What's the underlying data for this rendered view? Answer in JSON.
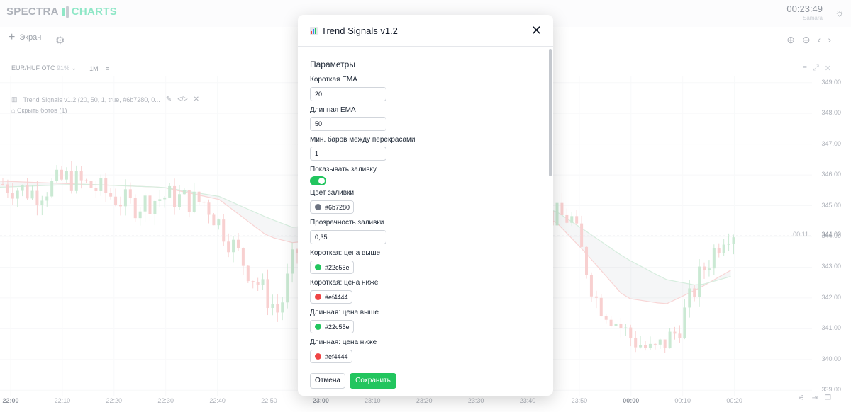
{
  "app": {
    "logo_left": "SPECTRA",
    "logo_right": "CHARTS",
    "clock": "00:23:49",
    "timezone": "Samara",
    "theme_icon": "sun-icon"
  },
  "toolbar": {
    "screen_label": "Экран",
    "add_icon": "plus-icon",
    "settings_icon": "gear-icon",
    "zoom_in_icon": "zoom-in-icon",
    "zoom_out_icon": "zoom-out-icon",
    "prev_icon": "chevron-left-icon",
    "next_icon": "chevron-right-icon"
  },
  "chart_header": {
    "symbol": "EUR/HUF OTC",
    "payout": "91%",
    "timeframe": "1M",
    "indicator": "Trend Signals v1.2 (20, 50, 1, true, #6b7280, 0...",
    "hide_bots": "Скрыть ботов (1)"
  },
  "chart_data": {
    "type": "candlestick",
    "y_ticks": [
      "349.00",
      "348.00",
      "347.00",
      "346.00",
      "345.00",
      "344.00",
      "343.00",
      "342.00",
      "341.00",
      "340.00",
      "339.00"
    ],
    "x_ticks": [
      "22:00",
      "22:10",
      "22:20",
      "22:30",
      "22:40",
      "22:50",
      "23:00",
      "23:10",
      "23:20",
      "23:30",
      "23:40",
      "23:50",
      "00:00",
      "00:10",
      "00:20"
    ],
    "x_ticks_bold": [
      "22:00",
      "23:00",
      "00:00"
    ],
    "current_price": "344.02",
    "current_timer": "00:11",
    "ylim": [
      338.8,
      349.2
    ],
    "up_color": "#22c55e",
    "down_color": "#ef4444",
    "ema_fill_color": "#6b7280",
    "close_path": [
      {
        "x": 0,
        "y": 345.7
      },
      {
        "x": 0.04,
        "y": 345.4
      },
      {
        "x": 0.08,
        "y": 345.9
      },
      {
        "x": 0.12,
        "y": 345.5
      },
      {
        "x": 0.16,
        "y": 345.0
      },
      {
        "x": 0.2,
        "y": 345.3
      },
      {
        "x": 0.25,
        "y": 345.1
      },
      {
        "x": 0.3,
        "y": 343.0
      },
      {
        "x": 0.34,
        "y": 341.5
      },
      {
        "x": 0.36,
        "y": 343.5
      },
      {
        "x": 0.66,
        "y": 344.7
      },
      {
        "x": 0.7,
        "y": 344.6
      },
      {
        "x": 0.73,
        "y": 342.0
      },
      {
        "x": 0.77,
        "y": 340.8
      },
      {
        "x": 0.8,
        "y": 340.2
      },
      {
        "x": 0.83,
        "y": 340.9
      },
      {
        "x": 0.86,
        "y": 342.8
      },
      {
        "x": 0.89,
        "y": 344.2
      }
    ],
    "ema_short": [
      {
        "x": 0,
        "y": 345.8
      },
      {
        "x": 0.1,
        "y": 345.7
      },
      {
        "x": 0.2,
        "y": 345.6
      },
      {
        "x": 0.27,
        "y": 345.2
      },
      {
        "x": 0.33,
        "y": 344.0
      },
      {
        "x": 0.36,
        "y": 343.8
      },
      {
        "x": 0.68,
        "y": 344.6
      },
      {
        "x": 0.72,
        "y": 343.5
      },
      {
        "x": 0.77,
        "y": 342.0
      },
      {
        "x": 0.82,
        "y": 341.8
      },
      {
        "x": 0.86,
        "y": 342.3
      },
      {
        "x": 0.9,
        "y": 342.9
      }
    ],
    "ema_long": [
      {
        "x": 0,
        "y": 345.6
      },
      {
        "x": 0.1,
        "y": 345.7
      },
      {
        "x": 0.2,
        "y": 345.6
      },
      {
        "x": 0.27,
        "y": 345.3
      },
      {
        "x": 0.33,
        "y": 344.6
      },
      {
        "x": 0.36,
        "y": 344.3
      },
      {
        "x": 0.68,
        "y": 344.9
      },
      {
        "x": 0.72,
        "y": 344.2
      },
      {
        "x": 0.77,
        "y": 343.3
      },
      {
        "x": 0.82,
        "y": 342.6
      },
      {
        "x": 0.86,
        "y": 342.4
      },
      {
        "x": 0.9,
        "y": 342.7
      }
    ]
  },
  "modal": {
    "title": "Trend Signals v1.2",
    "title_icon": "bar-chart-icon",
    "close_icon": "close-icon",
    "section": "Параметры",
    "fields": {
      "short_ema": {
        "label": "Короткая EMA",
        "value": "20"
      },
      "long_ema": {
        "label": "Длинная EMA",
        "value": "50"
      },
      "min_bars": {
        "label": "Мин. баров между перекрасами",
        "value": "1"
      },
      "show_fill": {
        "label": "Показывать заливку",
        "value": true
      },
      "fill_color": {
        "label": "Цвет заливки",
        "value": "#6b7280"
      },
      "fill_opacity": {
        "label": "Прозрачность заливки",
        "value": "0,35"
      },
      "short_above": {
        "label": "Короткая: цена выше",
        "value": "#22c55e"
      },
      "short_below": {
        "label": "Короткая: цена ниже",
        "value": "#ef4444"
      },
      "long_above": {
        "label": "Длинная: цена выше",
        "value": "#22c55e"
      },
      "long_below": {
        "label": "Длинная: цена ниже",
        "value": "#ef4444"
      }
    },
    "cancel_label": "Отмена",
    "save_label": "Сохранить"
  }
}
